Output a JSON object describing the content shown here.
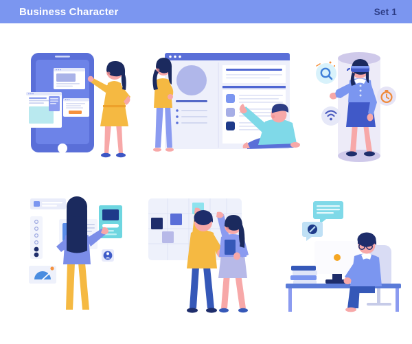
{
  "banner": {
    "title": "Business Character",
    "set_label": "Set 1",
    "background_color": "#7b96f0",
    "title_color": "#ffffff",
    "set_label_color": "#2c3c84"
  },
  "palette": {
    "page_background": "#ffffff",
    "blue_primary": "#5a6fd8",
    "blue_mid": "#6d83e8",
    "blue_light": "#8b9bf0",
    "lavender": "#aab3e8",
    "lavender_pale": "#e6e8f8",
    "navy_dark": "#1e2d6b",
    "navy_hair": "#1b2a5e",
    "cyan": "#6ed6e0",
    "cyan_light": "#b9e9ef",
    "yellow": "#f5b942",
    "yellow_deep": "#eda12b",
    "orange": "#f5913e",
    "skin": "#f7a8a8",
    "skin_deep": "#f09090",
    "white": "#ffffff",
    "off_white": "#f4f5fc",
    "line_gray": "#ccd2ea"
  },
  "scenes": [
    {
      "id": "mobile-app",
      "name": "Mobile App Presentation",
      "characters": [
        {
          "role": "woman-presenter",
          "hair": "#1b2a5e",
          "outfit": "#f5b942",
          "shoes": "#3d56c4",
          "skin": "#f7a8a8"
        }
      ],
      "objects": [
        "smartphone",
        "app-card-image",
        "app-card-text",
        "app-card-button"
      ],
      "cards": [
        {
          "name": "image-card",
          "accent": "#aab3e8"
        },
        {
          "name": "article-card",
          "accent": "#b9e9ef"
        },
        {
          "name": "cta-card",
          "accent": "#f5913e"
        }
      ]
    },
    {
      "id": "web-dashboard",
      "name": "Web Dashboard Review",
      "characters": [
        {
          "role": "woman-analyst",
          "hair": "#1b2a5e",
          "outfit": "#f5b942",
          "pants": "#8b9bf0",
          "skin": "#f7a8a8"
        },
        {
          "role": "man-pointer",
          "hair": "#2c3c84",
          "outfit": "#7fd9e8",
          "pants": "#5a6fd8",
          "skin": "#f7a8a8"
        }
      ],
      "objects": [
        "browser-window",
        "profile-avatar",
        "list-rows",
        "status-swatches"
      ],
      "swatches": [
        "#7b96f0",
        "#a6aee6",
        "#1e3a8a"
      ],
      "list_item_count": 3
    },
    {
      "id": "vr-experience",
      "name": "Virtual Reality Experience",
      "characters": [
        {
          "role": "woman-vr-user",
          "hair": "#1b2a5e",
          "top": "#7b96f0",
          "skirt": "#4059c8",
          "shoes": "#1e2d6b",
          "skin": "#f7a8a8"
        }
      ],
      "objects": [
        "vr-cylinder",
        "vr-headset",
        "floating-icon-badges"
      ],
      "floating_icons": [
        {
          "icon": "search-icon",
          "badge_color": "#d8f2fb",
          "glyph_color": "#3f7fd8"
        },
        {
          "icon": "wifi-icon",
          "badge_color": "#e6e8f8",
          "glyph_color": "#4a5bbf"
        },
        {
          "icon": "stopwatch-icon",
          "badge_color": "#e6e4f6",
          "glyph_color": "#ef8b3c"
        }
      ]
    },
    {
      "id": "ui-interaction",
      "name": "UI Interface Interaction",
      "characters": [
        {
          "role": "woman-back-view",
          "hair": "#1b2a5e",
          "top": "#7b8de8",
          "pants": "#f5b942",
          "skin": "#f7a8a8"
        }
      ],
      "objects": [
        "search-card",
        "slider-card",
        "gauge-card",
        "text-card",
        "terminal-card",
        "profile-badge"
      ],
      "cards": [
        {
          "name": "search-card",
          "accent": "#7b96f0"
        },
        {
          "name": "slider-card",
          "accent": "#1e2d6b"
        },
        {
          "name": "gauge-card",
          "accent": "#4a8de0"
        },
        {
          "name": "terminal-card",
          "accent": "#6ed6e0"
        },
        {
          "name": "profile-badge",
          "accent": "#3f5cc8"
        }
      ]
    },
    {
      "id": "planning-board",
      "name": "Team Planning Board",
      "characters": [
        {
          "role": "man-organizer",
          "hair": "#1e2d6b",
          "outfit": "#f5b942",
          "pants": "#3558b8",
          "shoes": "#1e2d6b",
          "skin": "#f7a8a8"
        },
        {
          "role": "woman-colleague",
          "hair": "#1b2a5e",
          "top": "#8b9bf0",
          "skirt": "#b7b9e8",
          "shoes": "#3558b8",
          "skin": "#f7a8a8"
        }
      ],
      "objects": [
        "grid-board",
        "sticky-notes",
        "tablet"
      ],
      "sticky_notes": [
        "#1e2d6b",
        "#5a6fd8",
        "#b7b9e8",
        "#8ee3ee"
      ]
    },
    {
      "id": "remote-work",
      "name": "Remote Work Desk",
      "characters": [
        {
          "role": "man-at-desk",
          "hair": "#1e2d6b",
          "glasses": true,
          "outfit": "#7b96f0",
          "pants": "#3558b8",
          "skin": "#f7a8a8"
        }
      ],
      "objects": [
        "desk",
        "monitor",
        "book-stack",
        "office-chair",
        "chat-bubble-text",
        "chat-bubble-blocked"
      ],
      "chat_bubbles": [
        {
          "name": "message-bubble",
          "color": "#7fd9e8"
        },
        {
          "name": "blocked-bubble",
          "color": "#bfe0f5",
          "glyph": "no-entry-icon"
        }
      ]
    }
  ]
}
